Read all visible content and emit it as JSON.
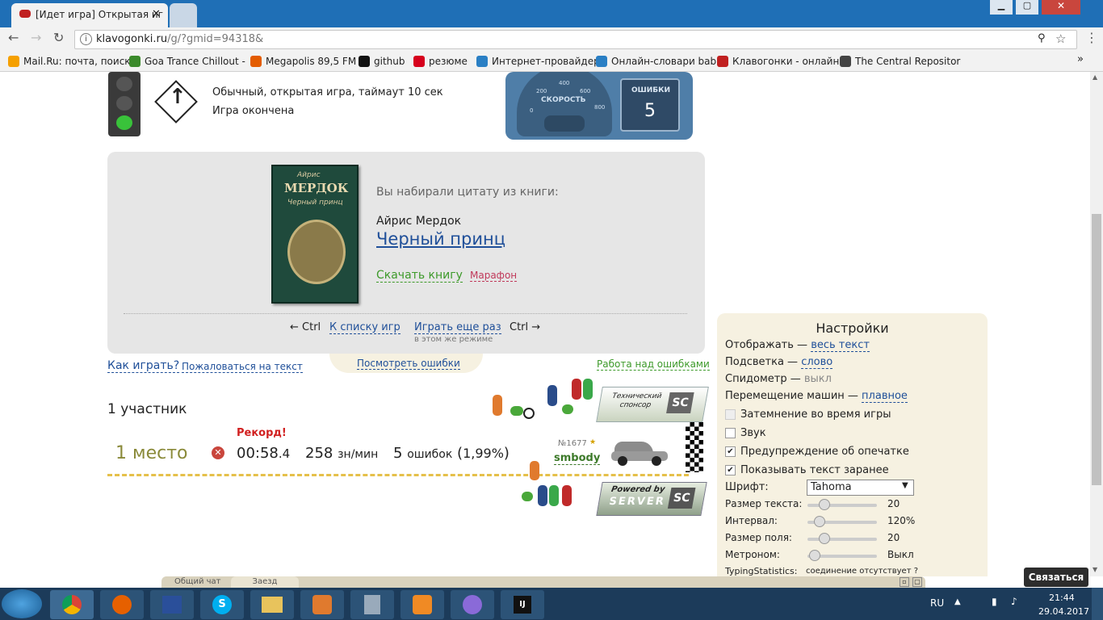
{
  "browser": {
    "tab_active_title": "[Идет игра] Открытая иг",
    "url_host": "klavogonki.ru",
    "url_path": "/g/?gmid=94318&",
    "bookmarks": [
      {
        "label": "Mail.Ru: почта, поиск",
        "icon": "mailru-icon",
        "color": "#f5a000"
      },
      {
        "label": "Goa Trance Chillout -",
        "icon": "palm-icon",
        "color": "#3b8a2b"
      },
      {
        "label": "Megapolis 89,5 FM",
        "icon": "radio-icon",
        "color": "#e35c00"
      },
      {
        "label": "github",
        "icon": "github-icon",
        "color": "#111111"
      },
      {
        "label": "резюме",
        "icon": "hh-icon",
        "color": "#d6001c"
      },
      {
        "label": "Интернет-провайдер",
        "icon": "globe-icon",
        "color": "#2a7fc4"
      },
      {
        "label": "Онлайн-словари bab",
        "icon": "chat-icon",
        "color": "#2a7fc4"
      },
      {
        "label": "Клавогонки - онлайн",
        "icon": "car-icon",
        "color": "#c02020"
      },
      {
        "label": "The Central Repositor",
        "icon": "list-icon",
        "color": "#444444"
      }
    ]
  },
  "game": {
    "mode_line": "Обычный, открытая игра, таймаут 10 сек",
    "status_line": "Игра окончена",
    "speedometer_label": "СКОРОСТЬ",
    "speed_ticks": [
      "0",
      "200",
      "400",
      "600",
      "800"
    ],
    "errors_label": "ОШИБКИ",
    "errors_value": "5"
  },
  "book": {
    "cover_author": "Айрис",
    "cover_surname": "МЕРДОК",
    "cover_title": "Черный принц",
    "intro": "Вы набирали цитату из книги:",
    "author": "Айрис Мердок",
    "title": "Черный принц",
    "download": "Скачать книгу",
    "marathon": "Марафон"
  },
  "nav": {
    "ctrl_left": "← Ctrl",
    "to_list": "К списку игр",
    "play_again": "Играть еще раз",
    "ctrl_right": "Ctrl →",
    "same_mode": "в этом же режиме"
  },
  "links": {
    "how_to_play": "Как играть?",
    "complain": "Пожаловаться на текст",
    "view_errors": "Посмотреть ошибки",
    "work_on_errors": "Работа над ошибками"
  },
  "results": {
    "participants": "1 участник",
    "place": "1 место",
    "record": "Рекорд!",
    "time_main": "00:58",
    "time_fraction": ".4",
    "speed_value": "258",
    "speed_unit": "зн/мин",
    "errors_value": "5",
    "errors_word": "ошибок",
    "errors_percent": "1,99%",
    "player_number": "№1677",
    "player_name": "smbody",
    "sponsor_label": "Технический спонсор",
    "powered_by": "Powered by",
    "server": "SERVER"
  },
  "settings": {
    "title": "Настройки",
    "display_label": "Отображать —",
    "display_value": "весь текст",
    "highlight_label": "Подсветка —",
    "highlight_value": "слово",
    "speedometer_label": "Спидометр —",
    "speedometer_value": "выкл",
    "cars_label": "Перемещение машин —",
    "cars_value": "плавное",
    "dim_label": "Затемнение во время игры",
    "sound_label": "Звук",
    "typo_warning_label": "Предупреждение об опечатке",
    "show_text_label": "Показывать текст заранее",
    "font_label": "Шрифт:",
    "font_value": "Tahoma",
    "text_size_label": "Размер текста:",
    "text_size_value": "20",
    "interval_label": "Интервал:",
    "interval_value": "120%",
    "field_size_label": "Размер поля:",
    "field_size_value": "20",
    "metronome_label": "Метроном:",
    "metronome_value": "Выкл",
    "typingstats_label": "TypingStatistics:",
    "typingstats_value": "соединение отсутствует ?"
  },
  "chat": {
    "tab_general": "Общий чат",
    "tab_race": "Заезд",
    "contact_button": "Связаться"
  },
  "taskbar": {
    "lang": "RU",
    "time": "21:44",
    "date": "29.04.2017"
  }
}
